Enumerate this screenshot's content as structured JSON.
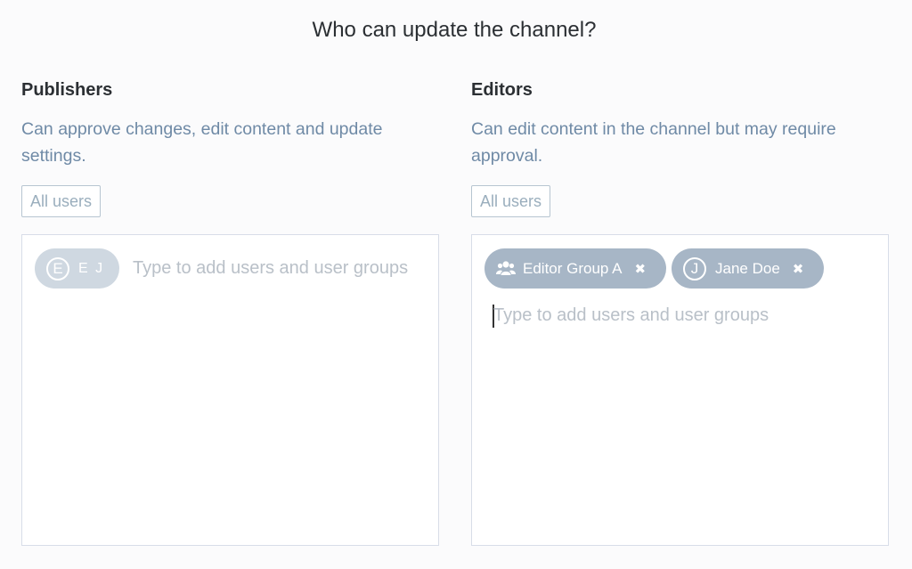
{
  "page_title": "Who can update the channel?",
  "publishers": {
    "heading": "Publishers",
    "description": "Can approve changes, edit content and update settings.",
    "all_users_label": "All users",
    "chips": [
      {
        "avatar_letter": "E",
        "label": "E J",
        "type": "user",
        "state": "disabled"
      }
    ],
    "placeholder": "Type to add users and user groups"
  },
  "editors": {
    "heading": "Editors",
    "description": "Can edit content in the channel but may require approval.",
    "all_users_label": "All users",
    "chips": [
      {
        "label": "Editor Group A",
        "type": "group",
        "icon": "users-group-icon",
        "remove_icon": "close-icon"
      },
      {
        "avatar_letter": "J",
        "label": "Jane Doe",
        "type": "user",
        "remove_icon": "close-icon"
      }
    ],
    "placeholder": "Type to add users and user groups"
  },
  "colors": {
    "heading": "#2b2f33",
    "description": "#6f8aa6",
    "chip": "#a7b6c6",
    "chip_disabled": "#cfd8e1",
    "placeholder": "#b9c0c8",
    "box_border": "#d8dde8"
  }
}
